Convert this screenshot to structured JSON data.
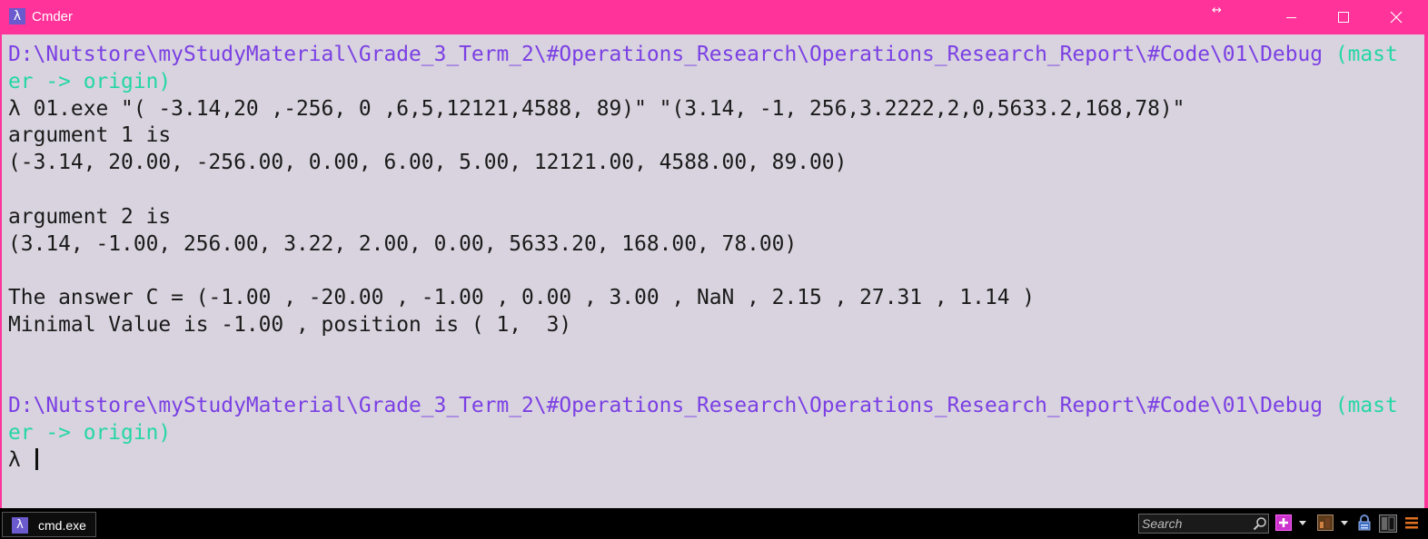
{
  "window": {
    "title": "Cmder",
    "app_icon_glyph": "λ",
    "resize_glyph": "↔",
    "accent_color": "#ff3399"
  },
  "console": {
    "lines": [
      [
        {
          "text": "D:\\Nutstore\\myStudyMaterial\\Grade_3_Term_2\\#Operations_Research\\Operations_Research_Report\\#Code\\01\\Debug",
          "type": "path"
        },
        {
          "text": " (mast",
          "type": "branch"
        }
      ],
      [
        {
          "text": "er -> origin)",
          "type": "branch"
        }
      ],
      [
        {
          "text": "λ 01.exe \"( -3.14,20 ,-256, 0 ,6,5,12121,4588, 89)\" \"(3.14, -1, 256,3.2222,2,0,5633.2,168,78)\"",
          "type": "text"
        }
      ],
      [
        {
          "text": "argument 1 is",
          "type": "text"
        }
      ],
      [
        {
          "text": "(-3.14, 20.00, -256.00, 0.00, 6.00, 5.00, 12121.00, 4588.00, 89.00)",
          "type": "text"
        }
      ],
      [
        {
          "text": "",
          "type": "text"
        }
      ],
      [
        {
          "text": "argument 2 is",
          "type": "text"
        }
      ],
      [
        {
          "text": "(3.14, -1.00, 256.00, 3.22, 2.00, 0.00, 5633.20, 168.00, 78.00)",
          "type": "text"
        }
      ],
      [
        {
          "text": "",
          "type": "text"
        }
      ],
      [
        {
          "text": "The answer C = (-1.00 , -20.00 , -1.00 , 0.00 , 3.00 , NaN , 2.15 , 27.31 , 1.14 )",
          "type": "text"
        }
      ],
      [
        {
          "text": "Minimal Value is -1.00 , position is ( 1,  3)",
          "type": "text"
        }
      ],
      [
        {
          "text": "",
          "type": "text"
        }
      ],
      [
        {
          "text": "",
          "type": "text"
        }
      ],
      [
        {
          "text": "D:\\Nutstore\\myStudyMaterial\\Grade_3_Term_2\\#Operations_Research\\Operations_Research_Report\\#Code\\01\\Debug",
          "type": "path"
        },
        {
          "text": " (mast",
          "type": "branch"
        }
      ],
      [
        {
          "text": "er -> origin)",
          "type": "branch"
        }
      ]
    ],
    "prompt": "λ ",
    "colors": {
      "background": "#d8d3de",
      "text": "#1a1a1a",
      "path": "#7b3fe4",
      "branch": "#24d7a4"
    }
  },
  "statusbar": {
    "tab_label": "cmd.exe",
    "tab_icon_glyph": "λ",
    "search_placeholder": "Search",
    "icons": [
      "search-icon",
      "plus-icon",
      "chevron-down-icon",
      "split-icon",
      "chevron-down-icon",
      "lock-icon",
      "panel-icon",
      "menu-icon"
    ]
  }
}
